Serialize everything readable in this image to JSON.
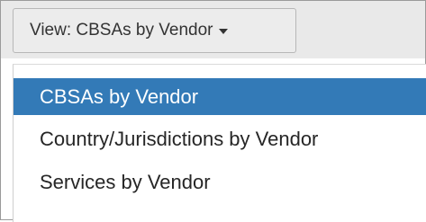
{
  "view_button": {
    "label": "View: CBSAs by Vendor",
    "icon": "caret-down-icon"
  },
  "menu": {
    "items": [
      {
        "label": "CBSAs by Vendor",
        "selected": true
      },
      {
        "label": "Country/Jurisdictions by Vendor",
        "selected": false
      },
      {
        "label": "Services by Vendor",
        "selected": false
      }
    ]
  },
  "colors": {
    "highlight": "#337ab7",
    "toolbar": "#e9e9e9",
    "text": "#262626"
  }
}
